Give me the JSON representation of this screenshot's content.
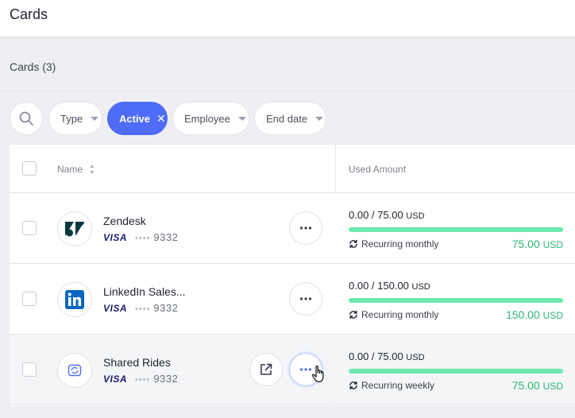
{
  "header": {
    "title": "Cards"
  },
  "section": {
    "title": "Cards (3)"
  },
  "filters": [
    {
      "label": "Type",
      "active": false
    },
    {
      "label": "Active",
      "active": true
    },
    {
      "label": "Employee",
      "active": false
    },
    {
      "label": "End date",
      "active": false
    }
  ],
  "table": {
    "columns": {
      "name": "Name",
      "used_amount": "Used Amount"
    },
    "rows": [
      {
        "name": "Zendesk",
        "brand": "VISA",
        "masked": "••••",
        "last4": "9332",
        "used": "0.00 / 75.00",
        "currency": "USD",
        "recurrence": "Recurring monthly",
        "limit": "75.00",
        "progress": 0
      },
      {
        "name": "LinkedIn Sales...",
        "brand": "VISA",
        "masked": "••••",
        "last4": "9332",
        "used": "0.00 / 150.00",
        "currency": "USD",
        "recurrence": "Recurring monthly",
        "limit": "150.00",
        "progress": 0
      },
      {
        "name": "Shared Rides",
        "brand": "VISA",
        "masked": "••••",
        "last4": "9332",
        "used": "0.00 / 75.00",
        "currency": "USD",
        "recurrence": "Recurring weekly",
        "limit": "75.00",
        "progress": 0
      }
    ]
  },
  "colors": {
    "accent": "#4e6cf7",
    "bar": "#6ee7b1",
    "limit": "#2bb673",
    "visa": "#1a1f71",
    "linkedin": "#0a66c2",
    "zendesk": "#03363d"
  },
  "icons": {
    "search": "search-icon",
    "more": "more-horizontal-icon",
    "open": "open-external-icon",
    "recurring": "repeat-icon",
    "sort": "sort-icon"
  }
}
